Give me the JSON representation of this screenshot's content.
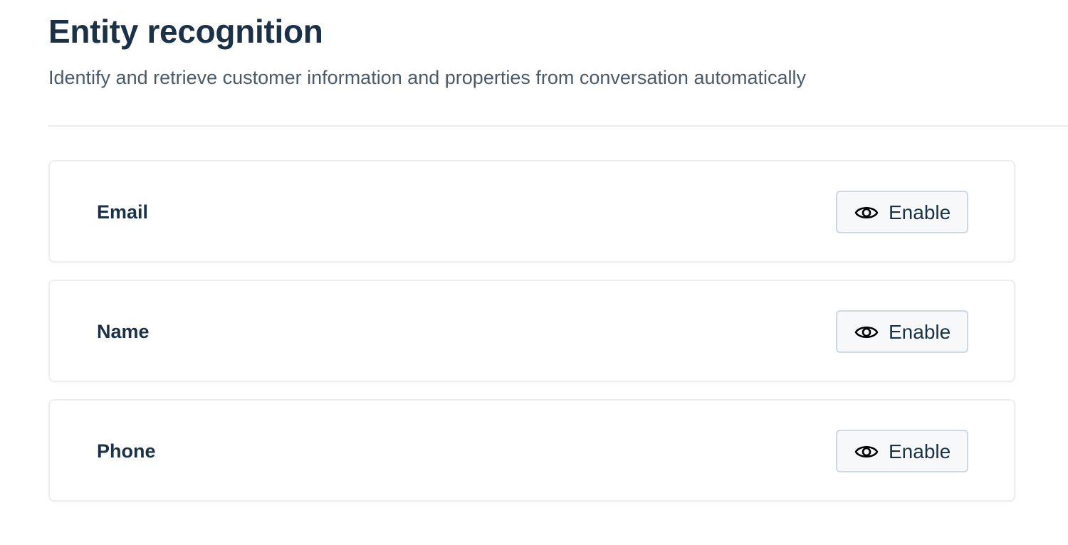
{
  "header": {
    "title": "Entity recognition",
    "subtitle": "Identify and retrieve customer information and properties from conversation automatically"
  },
  "entities": [
    {
      "label": "Email",
      "action_label": "Enable",
      "icon": "eye-icon"
    },
    {
      "label": "Name",
      "action_label": "Enable",
      "icon": "eye-icon"
    },
    {
      "label": "Phone",
      "action_label": "Enable",
      "icon": "eye-icon"
    }
  ],
  "colors": {
    "heading": "#1a3148",
    "subtitle": "#4a5a6a",
    "button_bg": "#f6f8fa",
    "button_border": "#cfd8e0",
    "card_border": "#eceef1"
  }
}
